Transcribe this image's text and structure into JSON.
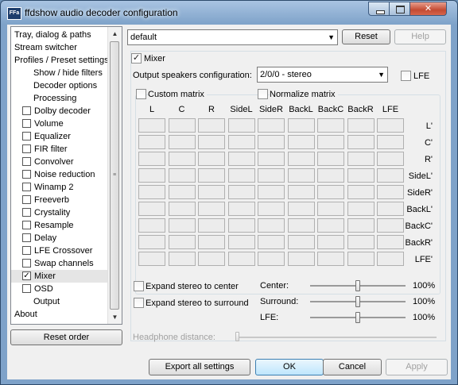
{
  "window": {
    "title": "ffdshow audio decoder configuration",
    "app_icon": "FFa"
  },
  "tree": {
    "items": [
      {
        "label": "Tray, dialog & paths",
        "checkbox": false,
        "checked": false,
        "indent": 0
      },
      {
        "label": "Stream switcher",
        "checkbox": false,
        "checked": false,
        "indent": 0
      },
      {
        "label": "Profiles / Preset settings",
        "checkbox": false,
        "checked": false,
        "indent": 0
      },
      {
        "label": "Show / hide filters",
        "checkbox": false,
        "checked": false,
        "indent": 2
      },
      {
        "label": "Decoder options",
        "checkbox": false,
        "checked": false,
        "indent": 2
      },
      {
        "label": "Processing",
        "checkbox": false,
        "checked": false,
        "indent": 2
      },
      {
        "label": "Dolby decoder",
        "checkbox": true,
        "checked": false,
        "indent": 1
      },
      {
        "label": "Volume",
        "checkbox": true,
        "checked": false,
        "indent": 1
      },
      {
        "label": "Equalizer",
        "checkbox": true,
        "checked": false,
        "indent": 1
      },
      {
        "label": "FIR filter",
        "checkbox": true,
        "checked": false,
        "indent": 1
      },
      {
        "label": "Convolver",
        "checkbox": true,
        "checked": false,
        "indent": 1
      },
      {
        "label": "Noise reduction",
        "checkbox": true,
        "checked": false,
        "indent": 1
      },
      {
        "label": "Winamp 2",
        "checkbox": true,
        "checked": false,
        "indent": 1
      },
      {
        "label": "Freeverb",
        "checkbox": true,
        "checked": false,
        "indent": 1
      },
      {
        "label": "Crystality",
        "checkbox": true,
        "checked": false,
        "indent": 1
      },
      {
        "label": "Resample",
        "checkbox": true,
        "checked": false,
        "indent": 1
      },
      {
        "label": "Delay",
        "checkbox": true,
        "checked": false,
        "indent": 1
      },
      {
        "label": "LFE Crossover",
        "checkbox": true,
        "checked": false,
        "indent": 1
      },
      {
        "label": "Swap channels",
        "checkbox": true,
        "checked": false,
        "indent": 1
      },
      {
        "label": "Mixer",
        "checkbox": true,
        "checked": true,
        "indent": 1,
        "selected": true
      },
      {
        "label": "OSD",
        "checkbox": true,
        "checked": false,
        "indent": 1
      },
      {
        "label": "Output",
        "checkbox": false,
        "checked": false,
        "indent": 2
      },
      {
        "label": "About",
        "checkbox": false,
        "checked": false,
        "indent": 0
      }
    ]
  },
  "reset_order_label": "Reset order",
  "preset": {
    "value": "default",
    "reset_label": "Reset",
    "help_label": "Help"
  },
  "mixer": {
    "enabled_label": "Mixer",
    "enabled": true,
    "output_label": "Output speakers configuration:",
    "output_value": "2/0/0 - stereo",
    "lfe_label": "LFE",
    "custom_matrix_label": "Custom matrix",
    "normalize_matrix_label": "Normalize matrix",
    "matrix_columns": [
      "L",
      "C",
      "R",
      "SideL",
      "SideR",
      "BackL",
      "BackC",
      "BackR",
      "LFE"
    ],
    "matrix_rows": [
      "L'",
      "C'",
      "R'",
      "SideL'",
      "SideR'",
      "BackL'",
      "BackC'",
      "BackR'",
      "LFE'"
    ],
    "expand_center_label": "Expand stereo to center",
    "expand_surround_label": "Expand stereo to surround",
    "levels": [
      {
        "label": "Center:",
        "value": "100%",
        "level": 0.5
      },
      {
        "label": "Surround:",
        "value": "100%",
        "level": 0.5
      },
      {
        "label": "LFE:",
        "value": "100%",
        "level": 0.5
      }
    ],
    "headphone_label": "Headphone distance:"
  },
  "footer": {
    "export_label": "Export all settings",
    "ok_label": "OK",
    "cancel_label": "Cancel",
    "apply_label": "Apply"
  }
}
